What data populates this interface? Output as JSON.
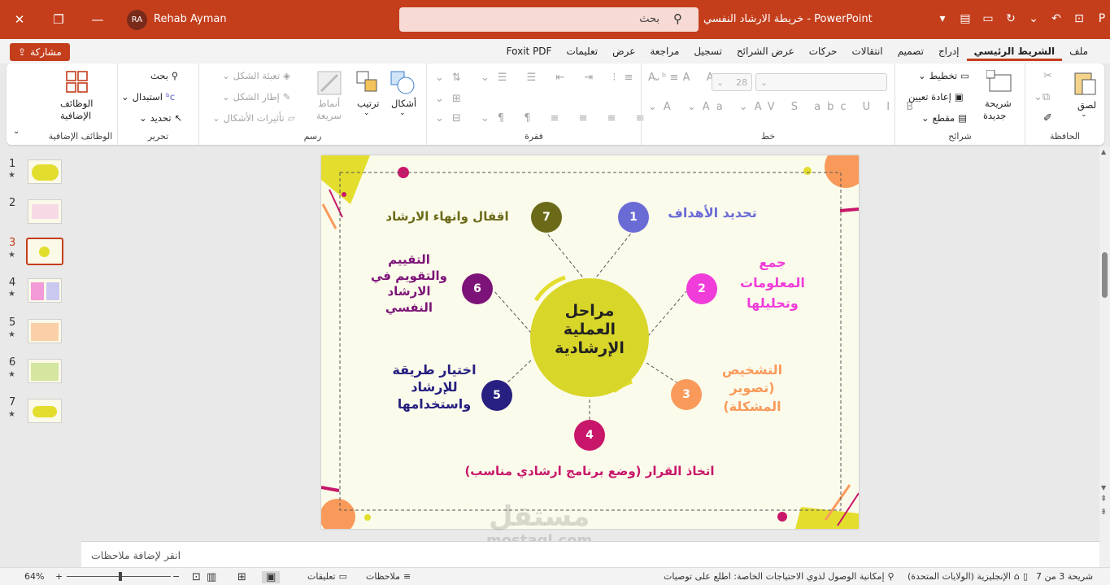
{
  "titlebar": {
    "user_initials": "RA",
    "user_name": "Rehab Ayman",
    "search_placeholder": "بحث",
    "doc_title": "خريطة الارشاد النفسي - PowerPoint"
  },
  "tabs_row": {
    "share_label": "مشاركة",
    "tabs": [
      "ملف",
      "الشريط الرئيسي",
      "إدراج",
      "تصميم",
      "انتقالات",
      "حركات",
      "عرض الشرائح",
      "تسجيل",
      "مراجعة",
      "عرض",
      "تعليمات",
      "Foxit PDF"
    ],
    "active_tab": "الشريط الرئيسي"
  },
  "ribbon": {
    "clipboard": {
      "label": "الحافظة",
      "paste": "لصق"
    },
    "slides": {
      "label": "شرائح",
      "new_slide_1": "شريحة",
      "new_slide_2": "جديدة",
      "layout": "تخطيط",
      "reset": "إعادة تعيين",
      "section": "مقطع"
    },
    "font": {
      "label": "خط",
      "size": "28"
    },
    "paragraph": {
      "label": "فقرة"
    },
    "drawing": {
      "label": "رسم",
      "shapes": "أشكال",
      "arrange": "ترتيب",
      "quick_styles_1": "أنماط",
      "quick_styles_2": "سريعة",
      "shape_fill": "تعبئة الشكل",
      "shape_outline": "إطار الشكل",
      "shape_effects": "تأثيرات الأشكال"
    },
    "editing": {
      "label": "تحرير",
      "find": "بحث",
      "replace": "استبدال",
      "select": "تحديد"
    },
    "addins": {
      "label": "الوظائف الإضافية",
      "btn_1": "الوظائف",
      "btn_2": "الإضافية"
    }
  },
  "thumbnails": [
    {
      "num": "1",
      "star": "★"
    },
    {
      "num": "2",
      "star": ""
    },
    {
      "num": "3",
      "star": "★"
    },
    {
      "num": "4",
      "star": "★"
    },
    {
      "num": "5",
      "star": "★"
    },
    {
      "num": "6",
      "star": "★"
    },
    {
      "num": "7",
      "star": "★"
    }
  ],
  "slide": {
    "center_line1": "مراحل",
    "center_line2": "العملية",
    "center_line3": "الإرشادية",
    "steps": [
      {
        "n": "1",
        "text": "تحديد الأهداف",
        "color": "#6b6bd6"
      },
      {
        "n": "2",
        "text_l1": "جمع",
        "text_l2": "المعلومات",
        "text_l3": "وتحليلها",
        "color": "#f03cd9"
      },
      {
        "n": "3",
        "text_l1": "التشخيص",
        "text_l2": "(تصوير",
        "text_l3": "المشكلة)",
        "color": "#f99a5b"
      },
      {
        "n": "4",
        "text": "اتخاذ القرار (وضع برنامج ارشادي مناسب)",
        "color": "#c8176a"
      },
      {
        "n": "5",
        "text_l1": "اختيار طريقة",
        "text_l2": "للإرشاد",
        "text_l3": "واستخدامها",
        "color": "#272080"
      },
      {
        "n": "6",
        "text_l1": "التقييم",
        "text_l2": "والتقويم في",
        "text_l3": "الارشاد",
        "text_l4": "النفسي",
        "color": "#7c1378"
      },
      {
        "n": "7",
        "text": "اقفال وانهاء الارشاد",
        "color": "#6b6a18"
      }
    ]
  },
  "notes_placeholder": "انقر لإضافة ملاحظات",
  "watermark": {
    "line1": "مستقل",
    "line2": "mostaql.com"
  },
  "statusbar": {
    "slide_info": "شريحة 3 من 7",
    "language": "الإنجليزية (الولايات المتحدة)",
    "accessibility": "إمكانية الوصول لذوي الاحتياجات الخاصة: اطلع على توصيات",
    "notes": "ملاحظات",
    "comments": "تعليقات",
    "zoom": "64%"
  }
}
